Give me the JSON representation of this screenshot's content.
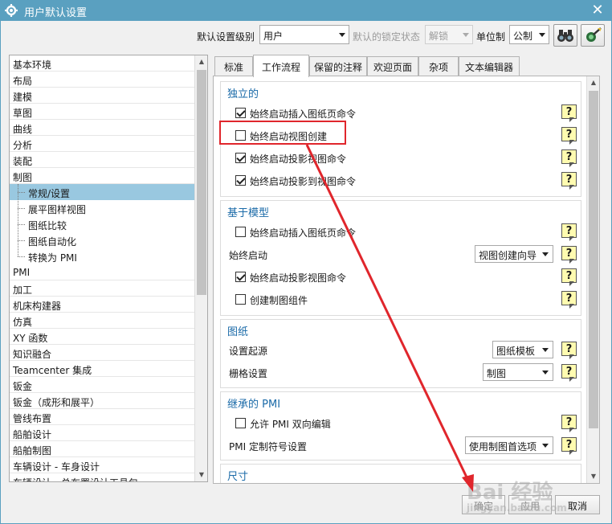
{
  "window": {
    "title": "用户默认设置",
    "close_glyph": "✕"
  },
  "toolbar": {
    "level_label": "默认设置级别",
    "level_value": "用户",
    "lock_label": "默认的锁定状态",
    "lock_value": "解锁",
    "unit_label": "单位制",
    "unit_value": "公制",
    "icons": [
      "binoculars-icon",
      "settings-wand-icon"
    ]
  },
  "tree": {
    "items": [
      "基本环境",
      "布局",
      "建模",
      "草图",
      "曲线",
      "分析",
      "装配",
      "制图"
    ],
    "children": [
      "常规/设置",
      "展平图样视图",
      "图纸比较",
      "图纸自动化",
      "转换为 PMI"
    ],
    "items_after": [
      "PMI",
      "加工",
      "机床构建器",
      "仿真",
      "XY 函数",
      "知识融合",
      "Teamcenter 集成",
      "钣金",
      "钣金（成形和展平）",
      "管线布置",
      "船舶设计",
      "船舶制图",
      "车辆设计 - 车身设计",
      "车辆设计 - 总布置设计工具包"
    ]
  },
  "tabs": [
    "标准",
    "工作流程",
    "保留的注释",
    "欢迎页面",
    "杂项",
    "文本编辑器"
  ],
  "groups": {
    "independent": {
      "title": "独立的",
      "options": [
        {
          "label": "始终启动插入图纸页命令",
          "checked": true
        },
        {
          "label": "始终启动视图创建",
          "checked": false
        },
        {
          "label": "始终启动投影视图命令",
          "checked": true
        },
        {
          "label": "始终启动投影到视图命令",
          "checked": true
        }
      ]
    },
    "model_based": {
      "title": "基于模型",
      "opt1": {
        "label": "始终启动插入图纸页命令",
        "checked": false
      },
      "start_label": "始终启动",
      "start_value": "视图创建向导",
      "opt2": {
        "label": "始终启动投影视图命令",
        "checked": true
      },
      "opt3": {
        "label": "创建制图组件",
        "checked": false
      }
    },
    "sheet": {
      "title": "图纸",
      "origin_label": "设置起源",
      "origin_value": "图纸模板",
      "grid_label": "栅格设置",
      "grid_value": "制图"
    },
    "pmi": {
      "title": "继承的 PMI",
      "opt1": {
        "label": "允许 PMI 双向编辑",
        "checked": false
      },
      "symbol_label": "PMI 定制符号设置",
      "symbol_value": "使用制图首选项"
    },
    "dimension": {
      "title": "尺寸"
    }
  },
  "help_glyph": "?",
  "footer": {
    "ok": "确定",
    "apply": "应用",
    "cancel": "取消"
  },
  "watermark": {
    "text": "Bai 经验",
    "sub": "jingyan.baidu.com"
  },
  "colors": {
    "titlebar": "#5aa0c0",
    "selection": "#99c8e0",
    "group_title": "#1a6aa8",
    "annotation": "#e0262c",
    "help_bg": "#fffbb0"
  }
}
